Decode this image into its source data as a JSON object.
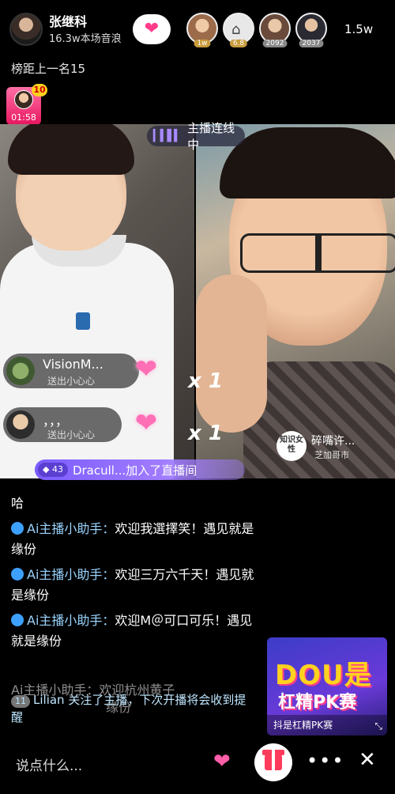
{
  "host": {
    "name": "张继科",
    "subtitle": "16.3w本场音浪"
  },
  "viewers": [
    {
      "badge": "1w"
    },
    {
      "badge": "6.8"
    },
    {
      "badge": "2092"
    },
    {
      "badge": "2037"
    }
  ],
  "viewer_count": "1.5w",
  "rank_text": "榜距上一名15",
  "gift_box": {
    "badge": "10",
    "timer": "01:58"
  },
  "link_status": "主播连线中",
  "likes": [
    {
      "name": "VisionM...",
      "action": "送出小心心",
      "multiplier": "x 1"
    },
    {
      "name": "，，，",
      "action": "送出小心心",
      "multiplier": "x 1"
    }
  ],
  "guest": {
    "tag": "知识女性",
    "name": "碎嘴许...",
    "location": "芝加哥市"
  },
  "join_banner": {
    "level": "43",
    "text": "Dracull...加入了直播间"
  },
  "chat": [
    {
      "who": "Ai主播小助手：",
      "text": "欢迎我選擇笑！遇见就是缘份"
    },
    {
      "who": "Ai主播小助手：",
      "text": "欢迎三万六千天！遇见就是缘份"
    },
    {
      "who": "Ai主播小助手：",
      "text": "欢迎M＠可口可乐！遇见就是缘份"
    }
  ],
  "chat_partial_top": "哈",
  "faded_line": "Ai主播小助手：欢迎杭州黄子",
  "faded_tail": "缘份",
  "notice": {
    "level": "11",
    "text": "Lilian 关注了主播，下次开播将会收到提醒"
  },
  "pk": {
    "big": "DOU是",
    "title": "杠精PK赛",
    "footer": "抖是杠精PK赛"
  },
  "bottom": {
    "placeholder": "说点什么..."
  },
  "colors": {
    "accent_pink": "#ff3b8b",
    "join_purple": "#7b5cff",
    "pk_yellow": "#ffd21f"
  }
}
